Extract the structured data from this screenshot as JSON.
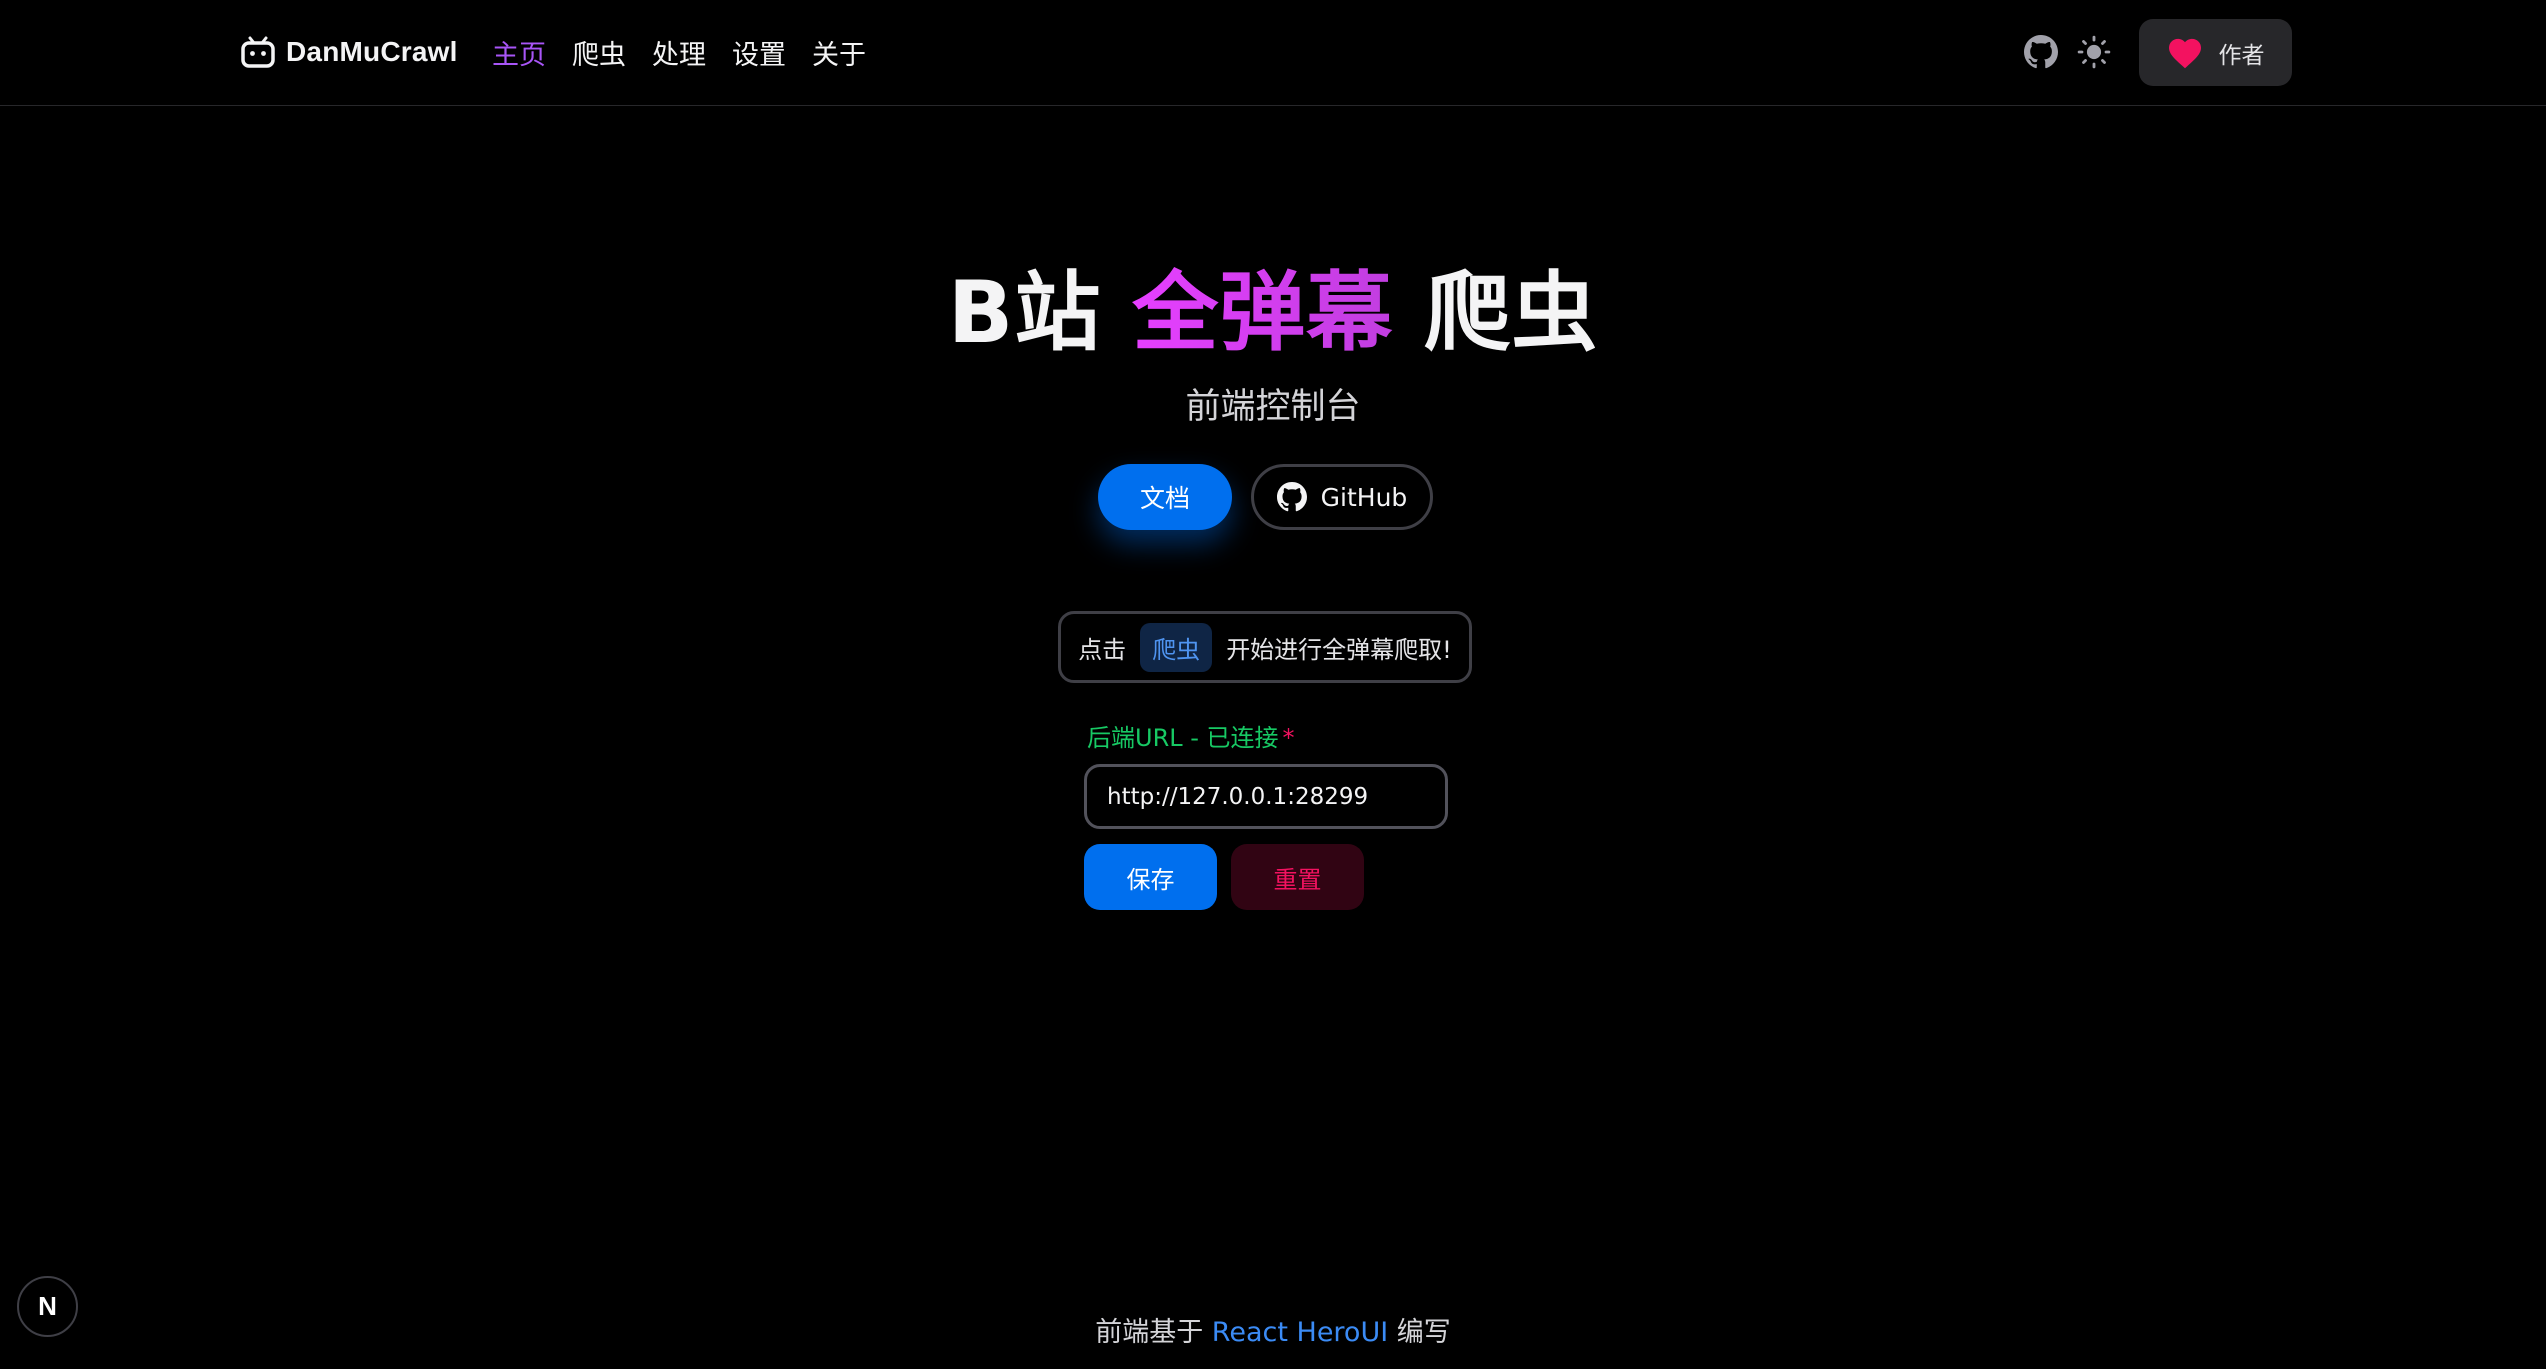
{
  "navbar": {
    "brand_name": "DanMuCrawl",
    "links": [
      {
        "label": "主页",
        "active": true
      },
      {
        "label": "爬虫",
        "active": false
      },
      {
        "label": "处理",
        "active": false
      },
      {
        "label": "设置",
        "active": false
      },
      {
        "label": "关于",
        "active": false
      }
    ],
    "github_icon": "github-icon",
    "theme_icon": "sun-icon",
    "author_button": {
      "icon": "heart-icon",
      "label": "作者"
    }
  },
  "hero": {
    "title_prefix": "B站 ",
    "title_highlight": "全弹幕",
    "title_suffix": " 爬虫",
    "subtitle": "前端控制台",
    "docs_button": "文档",
    "github_button": "GitHub"
  },
  "hint": {
    "prefix": "点击",
    "chip": "爬虫",
    "suffix": "开始进行全弹幕爬取!"
  },
  "backend": {
    "label": "后端URL - 已连接",
    "required_mark": "*",
    "url_value": "http://127.0.0.1:28299",
    "save_label": "保存",
    "reset_label": "重置"
  },
  "footer": {
    "prefix": "前端基于 ",
    "link": "React HeroUI",
    "suffix": " 编写"
  },
  "next_indicator": "N",
  "colors": {
    "background": "#000000",
    "primary": "#006fee",
    "accent_purple": "#a855f7",
    "gradient_magenta": "#e63fff",
    "success_green": "#17c964",
    "danger_red": "#f31260",
    "heart_pink": "#f31260"
  }
}
